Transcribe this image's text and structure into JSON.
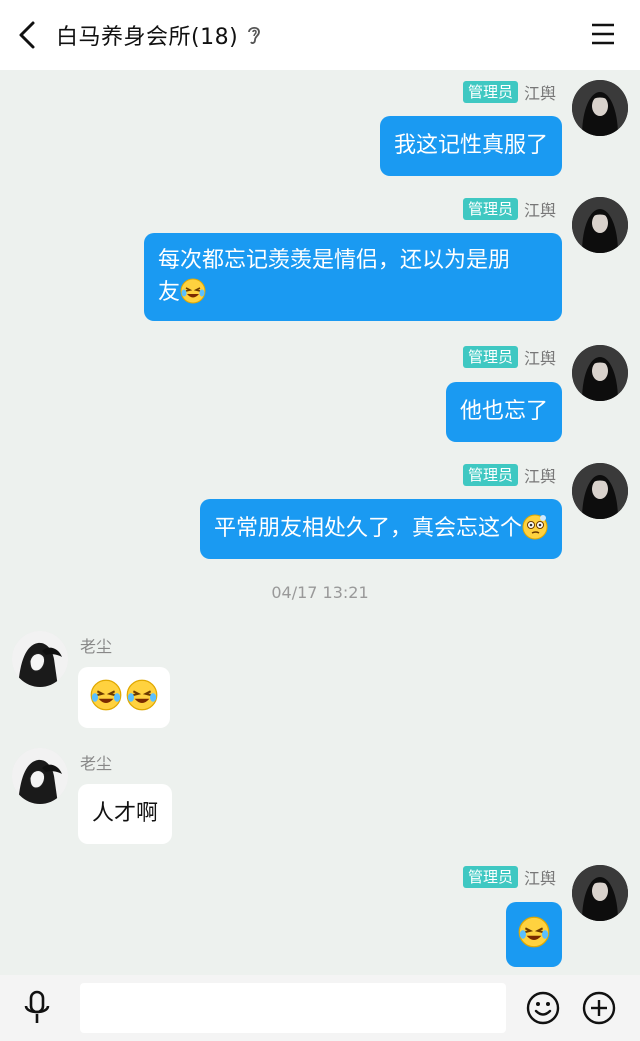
{
  "header": {
    "title": "白马养身会所(18)",
    "back_icon": "chevron-left-icon",
    "ear_icon": "ear-icon",
    "menu_icon": "hamburger-menu-icon"
  },
  "messages": [
    {
      "side": "right",
      "badge": "管理员",
      "sender": "江舆",
      "text": "我这记性真服了"
    },
    {
      "side": "right",
      "badge": "管理员",
      "sender": "江舆",
      "text_line1": "每次都忘记羡羡是情侣，还以为是朋",
      "text_line2": "友",
      "emoji": "laughing-tears-emoji"
    },
    {
      "side": "right",
      "badge": "管理员",
      "sender": "江舆",
      "text": "他也忘了"
    },
    {
      "side": "right",
      "badge": "管理员",
      "sender": "江舆",
      "text": "平常朋友相处久了，真会忘这个",
      "emoji": "thinking-emoji"
    },
    {
      "timestamp": "04/17 13:21"
    },
    {
      "side": "left",
      "sender": "老尘",
      "emoji": "laughing-tears-emoji x2"
    },
    {
      "side": "left",
      "sender": "老尘",
      "text": "人才啊"
    },
    {
      "side": "right",
      "badge": "管理员",
      "sender": "江舆",
      "emoji": "laughing-tears-emoji"
    }
  ],
  "bottom": {
    "mic_icon": "microphone-icon",
    "input_value": "",
    "emoji_icon": "smiley-icon",
    "plus_icon": "plus-circle-icon"
  },
  "colors": {
    "chat_bg": "#edf1ee",
    "bubble_self": "#1a9af2",
    "bubble_other": "#ffffff",
    "admin_badge": "#3fc8c2"
  }
}
